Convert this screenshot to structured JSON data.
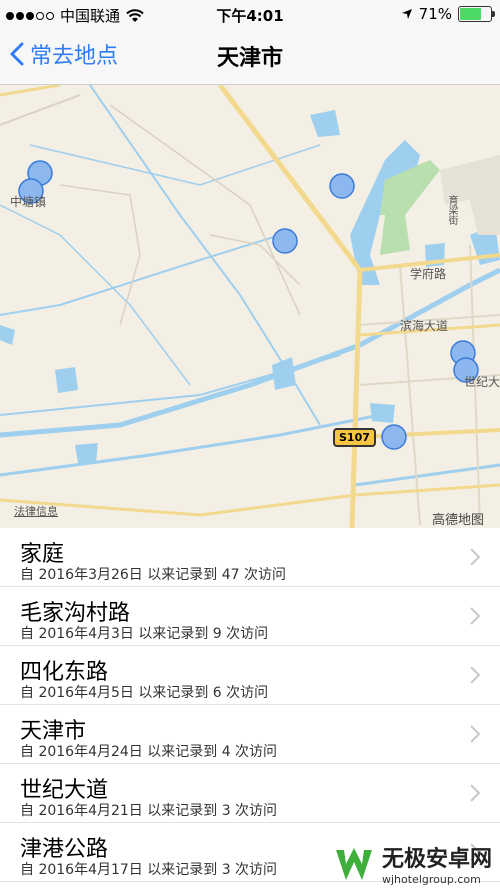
{
  "status": {
    "carrier": "中国联通",
    "time": "下午4:01",
    "battery": "71%",
    "battery_level": 0.71
  },
  "nav": {
    "back_label": "常去地点",
    "title": "天津市"
  },
  "map": {
    "labels": {
      "zhongtang": "中塘镇",
      "yulai": "育梁街",
      "xuefu": "学府路",
      "binhai": "滨海大道",
      "shiji": "世纪大",
      "legal": "法律信息",
      "provider": "高德地图",
      "route": "S107"
    }
  },
  "places": [
    {
      "name": "家庭",
      "detail": "自 2016年3月26日 以来记录到 47 次访问"
    },
    {
      "name": "毛家沟村路",
      "detail": "自 2016年4月3日 以来记录到 9 次访问"
    },
    {
      "name": "四化东路",
      "detail": "自 2016年4月5日 以来记录到 6 次访问"
    },
    {
      "name": "天津市",
      "detail": "自 2016年4月24日 以来记录到 4 次访问"
    },
    {
      "name": "世纪大道",
      "detail": "自 2016年4月21日 以来记录到 3 次访问"
    },
    {
      "name": "津港公路",
      "detail": "自 2016年4月17日 以来记录到 3 次访问"
    }
  ],
  "watermark": {
    "brand": "无极安卓网",
    "url": "wjhotelgroup.com"
  }
}
